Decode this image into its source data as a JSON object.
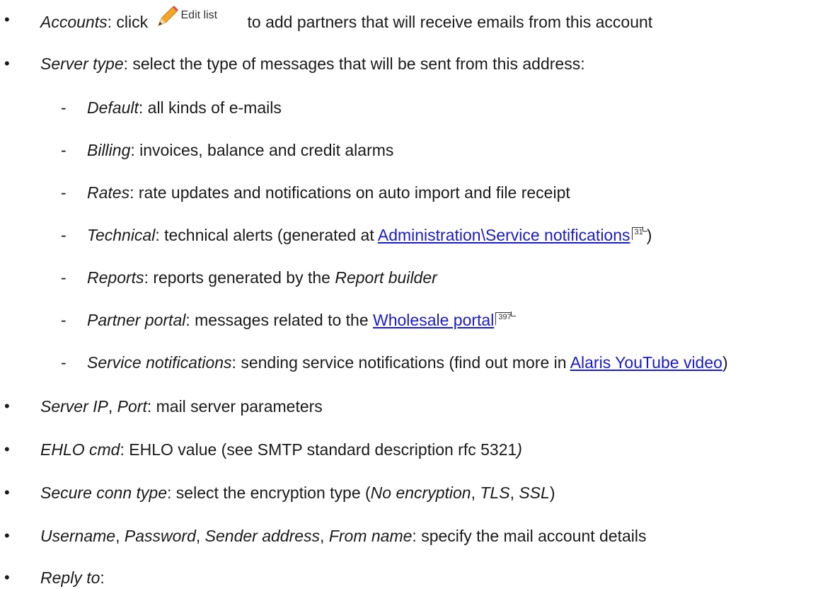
{
  "items": {
    "accounts": {
      "term": "Accounts",
      "pre": ": click",
      "button_label": "Edit list",
      "post": "to add partners that will receive emails from this account"
    },
    "server_type": {
      "term": "Server type",
      "text": ": select the type of messages that will be sent from this address:"
    },
    "sub": {
      "default": {
        "term": "Default",
        "text": ": all kinds of e-mails"
      },
      "billing": {
        "term": "Billing",
        "text": ": invoices, balance and credit alarms"
      },
      "rates": {
        "term": "Rates",
        "text": ": rate updates and notifications on auto import and file receipt"
      },
      "technical": {
        "term": "Technical",
        "text": ": technical alerts (generated at ",
        "link": "Administration\\Service notifications",
        "page": "31",
        "close": ")"
      },
      "reports": {
        "term": "Reports",
        "text": ": reports generated by the ",
        "term2": "Report builder"
      },
      "partner_portal": {
        "term": "Partner portal",
        "text": ": messages related to the ",
        "link": "Wholesale portal",
        "page": "397"
      },
      "service_notifications": {
        "term": "Service notifications",
        "text": ": sending service notifications (find out more in ",
        "link": "Alaris YouTube video",
        "close": ")"
      }
    },
    "server_ip": {
      "term1": "Server IP",
      "sep": ", ",
      "term2": "Port",
      "text": ": mail server parameters"
    },
    "ehlo": {
      "term": "EHLO cmd",
      "text": ": EHLO value (see SMTP standard description rfc 5321",
      "close": ")"
    },
    "secure": {
      "term": "Secure conn type",
      "text": ": select the encryption type (",
      "opt1": "No encryption",
      "opt2": "TLS",
      "opt3": "SSL",
      "sep": ", ",
      "close": ")"
    },
    "username": {
      "term1": "Username",
      "term2": "Password",
      "term3": "Sender address",
      "term4": "From name",
      "sep": ", ",
      "text": ": specify the mail account details"
    },
    "reply_to": {
      "term": "Reply to",
      "text": ":"
    }
  },
  "bullet_char": "•",
  "dash_char": "-",
  "icons": {
    "edit": "pencil-icon"
  }
}
